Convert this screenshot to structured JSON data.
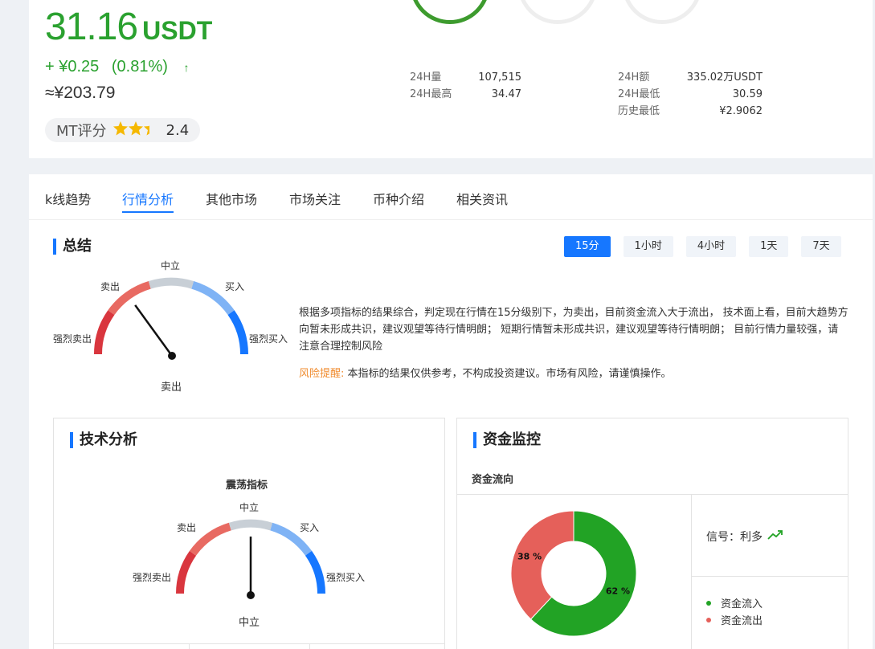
{
  "ticker": {
    "price": "31.16",
    "unit": "USDT",
    "change_abs": "+ ¥0.25",
    "change_pct": "(0.81%)",
    "change_arrow": "↑",
    "approx_cny": "≈¥203.79",
    "rating_label": "MT评分",
    "rating_value": "2.4",
    "rating_stars": 2.4,
    "up_color": "#2aa12f"
  },
  "stats": {
    "left": [
      {
        "label": "24H量",
        "value": "107,515"
      },
      {
        "label": "24H最高",
        "value": "34.47"
      }
    ],
    "right": [
      {
        "label": "24H额",
        "value": "335.02万USDT"
      },
      {
        "label": "24H最低",
        "value": "30.59"
      },
      {
        "label": "历史最低",
        "value": "¥2.9062"
      }
    ]
  },
  "tabs": [
    {
      "label": "k线趋势",
      "active": false
    },
    {
      "label": "行情分析",
      "active": true
    },
    {
      "label": "其他市场",
      "active": false
    },
    {
      "label": "市场关注",
      "active": false
    },
    {
      "label": "币种介绍",
      "active": false
    },
    {
      "label": "相关资讯",
      "active": false
    }
  ],
  "summary": {
    "title": "总结",
    "periods": [
      {
        "label": "15分",
        "active": true
      },
      {
        "label": "1小时",
        "active": false
      },
      {
        "label": "4小时",
        "active": false
      },
      {
        "label": "1天",
        "active": false
      },
      {
        "label": "7天",
        "active": false
      }
    ],
    "gauge": {
      "labels": {
        "strong_sell": "强烈卖出",
        "sell": "卖出",
        "neutral": "中立",
        "buy": "买入",
        "strong_buy": "强烈买入"
      },
      "result": "卖出",
      "needle_level": 0.3
    },
    "text": "根据多项指标的结果综合，判定现在行情在15分级别下，为卖出，目前资金流入大于流出， 技术面上看，目前大趋势方向暂未形成共识，建议观望等待行情明朗； 短期行情暂未形成共识，建议观望等待行情明朗； 目前行情力量较强，请注意合理控制风险",
    "risk_label": "风险提醒:",
    "risk_text": " 本指标的结果仅供参考，不构成投资建议。市场有风险，请谨慎操作。"
  },
  "technical": {
    "title": "技术分析",
    "gauge_title": "震荡指标",
    "gauge": {
      "labels": {
        "strong_sell": "强烈卖出",
        "sell": "卖出",
        "neutral": "中立",
        "buy": "买入",
        "strong_buy": "强烈买入"
      },
      "result": "中立",
      "needle_level": 0.5
    }
  },
  "funds": {
    "title": "资金监控",
    "flow_label": "资金流向",
    "signal_label": "信号：利多",
    "legend": [
      {
        "label": "资金流入",
        "color": "#22a325"
      },
      {
        "label": "资金流出",
        "color": "#e5605a"
      }
    ]
  },
  "chart_data": {
    "type": "pie",
    "categories": [
      "资金流入",
      "资金流出"
    ],
    "values": [
      62,
      38
    ],
    "labels": [
      "62 %",
      "38 %"
    ],
    "colors": [
      "#22a325",
      "#e5605a"
    ],
    "donut": true
  },
  "gauge_colors": {
    "strong_sell": "#d9363e",
    "sell": "#e86a62",
    "neutral": "#c8cfd6",
    "buy": "#7fb3f5",
    "strong_buy": "#1677ff"
  }
}
